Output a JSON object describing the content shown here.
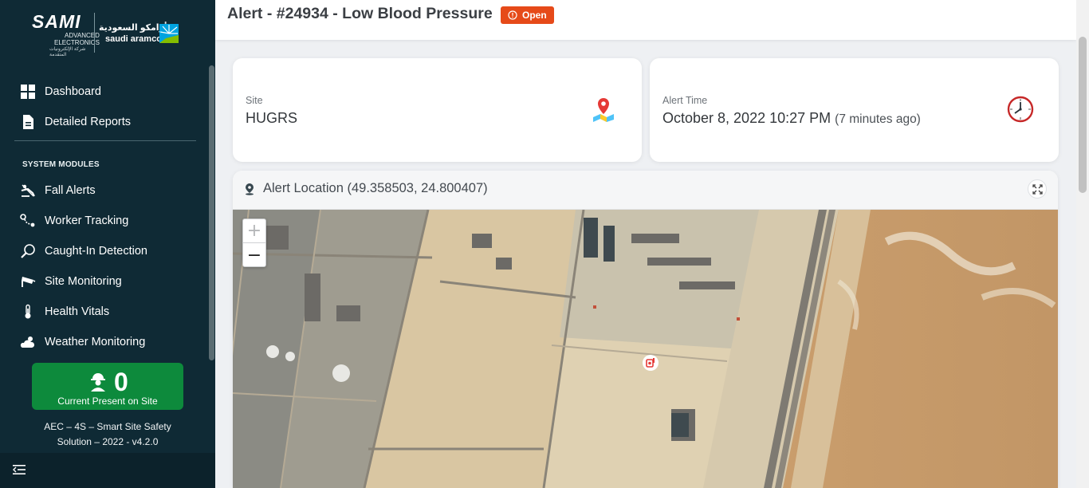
{
  "brand": {
    "sami_name": "SAMI",
    "sami_sub_line1": "ADVANCED",
    "sami_sub_line2": "ELECTRONICS",
    "sami_arabic": "شركة الإلكترونيات المتقدمة",
    "aramco_arabic": "أرامكو السعودية",
    "aramco_latin": "saudi aramco"
  },
  "sidebar": {
    "primary": [
      {
        "label": "Dashboard",
        "icon": "dashboard-grid-icon"
      },
      {
        "label": "Detailed Reports",
        "icon": "document-icon"
      }
    ],
    "section_title": "SYSTEM MODULES",
    "modules": [
      {
        "label": "Fall Alerts",
        "icon": "fall-person-icon"
      },
      {
        "label": "Worker Tracking",
        "icon": "route-icon"
      },
      {
        "label": "Caught-In Detection",
        "icon": "magnifier-icon"
      },
      {
        "label": "Site Monitoring",
        "icon": "cctv-camera-icon"
      },
      {
        "label": "Health Vitals",
        "icon": "thermometer-icon"
      },
      {
        "label": "Weather Monitoring",
        "icon": "weather-cloud-icon"
      }
    ],
    "present": {
      "count": "0",
      "label": "Current Present on Site"
    },
    "footer_line1": "AEC – 4S – Smart Site Safety",
    "footer_line2": "Solution – 2022 - v4.2.0"
  },
  "header": {
    "title": "Alert - #24934 - Low Blood Pressure",
    "status": "Open",
    "status_color": "#e64a19"
  },
  "site_card": {
    "label": "Site",
    "value": "HUGRS"
  },
  "time_card": {
    "label": "Alert Time",
    "value": "October 8, 2022 10:27 PM",
    "relative": "(7 minutes ago)"
  },
  "map": {
    "title": "Alert Location (49.358503, 24.800407)",
    "zoom_in": "+",
    "zoom_out": "−"
  },
  "colors": {
    "sidebar_bg": "#0f2a35",
    "present_green": "#0d8a3c",
    "accent_orange": "#e64a19"
  }
}
